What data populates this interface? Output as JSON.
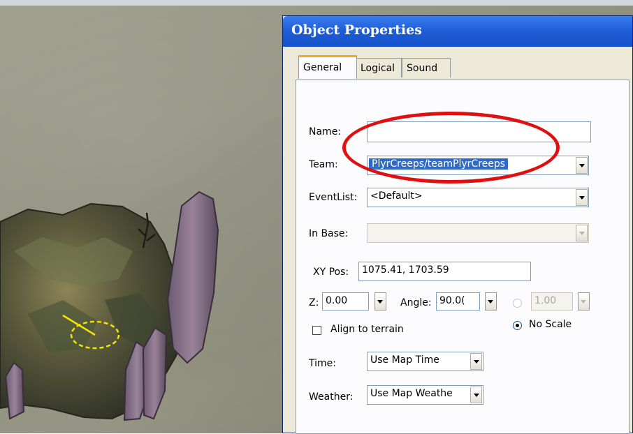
{
  "dialog": {
    "title": "Object Properties",
    "tabs": [
      {
        "label": "General",
        "active": true
      },
      {
        "label": "Logical",
        "active": false
      },
      {
        "label": "Sound",
        "active": false
      }
    ]
  },
  "general": {
    "name_label": "Name:",
    "name_value": "",
    "team_label": "Team:",
    "team_value": "PlyrCreeps/teamPlyrCreeps",
    "eventlist_label": "EventList:",
    "eventlist_value": "<Default>",
    "inbase_label": "In Base:",
    "inbase_value": "",
    "xypos_label": "XY Pos:",
    "xypos_value": "1075.41, 1703.59",
    "z_label": "Z:",
    "z_value": "0.00",
    "angle_label": "Angle:",
    "angle_value": "90.0(",
    "scale_value": "1.00",
    "no_scale_label": "No Scale",
    "align_label": "Align to terrain",
    "time_label": "Time:",
    "time_value": "Use Map Time",
    "weather_label": "Weather:",
    "weather_value": "Use Map Weathe"
  },
  "colors": {
    "titlebar": "#1f5fd8",
    "highlight": "#316ac5",
    "annotation": "#e01010",
    "selection_marker": "#f2e600"
  }
}
